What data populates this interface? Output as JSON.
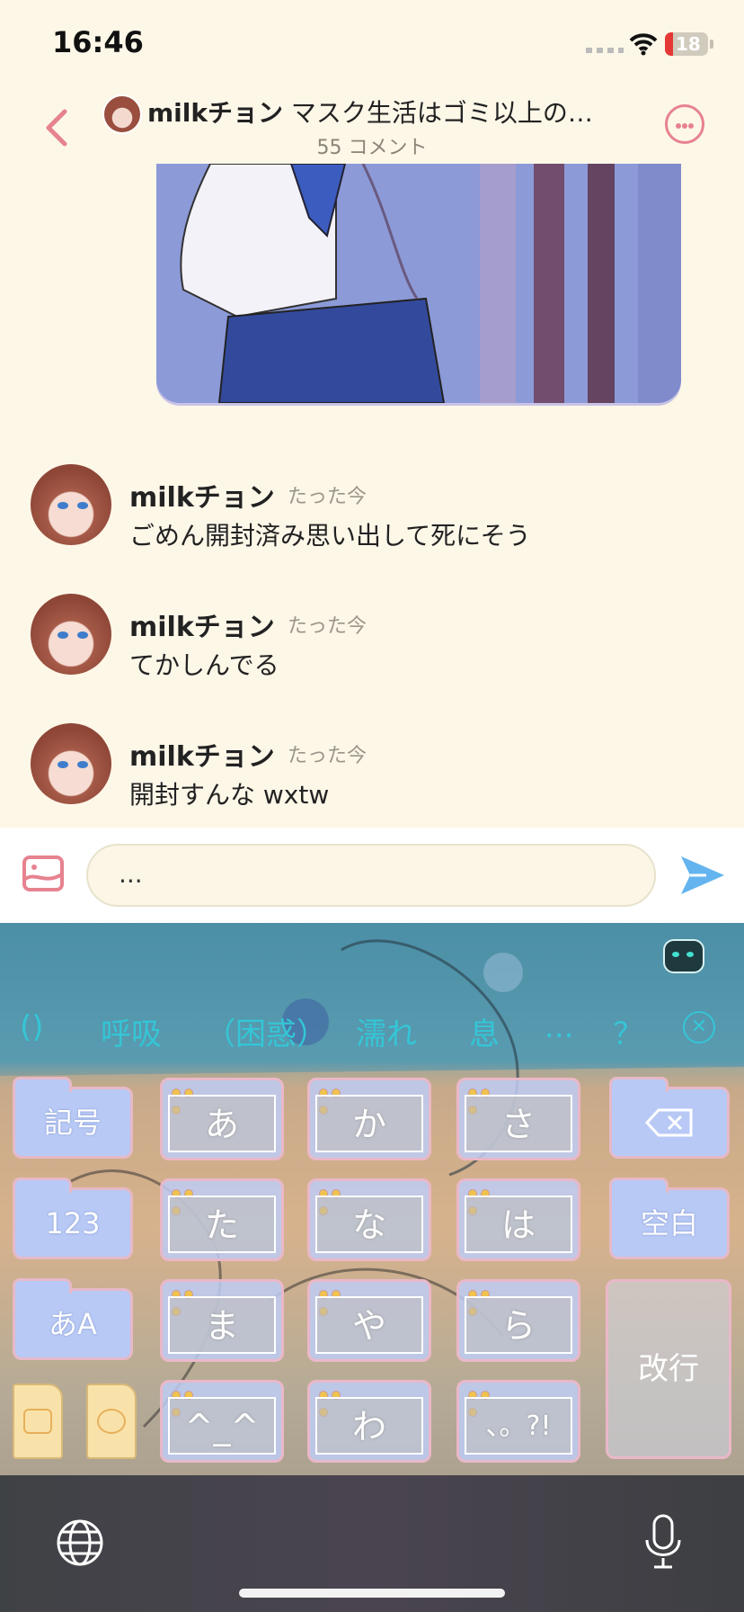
{
  "status_bar": {
    "time": "16:46",
    "battery": "18",
    "battery_level": 0.18
  },
  "header": {
    "user": "milkチョン",
    "title": "マスク生活はゴミ以上の…",
    "subtitle": "55 コメント"
  },
  "comments": [
    {
      "user": "milkチョン",
      "time": "たった今",
      "text": "ごめん開封済み思い出して死にそう"
    },
    {
      "user": "milkチョン",
      "time": "たった今",
      "text": "てかしんでる"
    },
    {
      "user": "milkチョン",
      "time": "たった今",
      "text": "開封すんな wxtw"
    }
  ],
  "composer": {
    "value": "..."
  },
  "keyboard": {
    "candidates": [
      "()",
      "呼吸",
      "（困惑）",
      "濡れ",
      "息",
      "...",
      "？"
    ],
    "left_keys": [
      "記号",
      "123",
      "あA"
    ],
    "keys": [
      "あ",
      "か",
      "さ",
      "た",
      "な",
      "は",
      "ま",
      "や",
      "ら",
      "^_^",
      "わ",
      "、。?!"
    ],
    "right_keys": [
      "空白",
      "改行"
    ]
  },
  "colors": {
    "accent": "#e7828f",
    "candidate": "#34c6d6",
    "send": "#63b4ef",
    "background": "#fdf7e8"
  },
  "icons": [
    "back-icon",
    "more-icon",
    "image-icon",
    "send-icon",
    "delete-icon",
    "globe-icon",
    "microphone-icon"
  ]
}
